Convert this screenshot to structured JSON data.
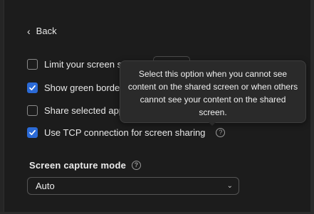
{
  "nav": {
    "back_label": "Back"
  },
  "options": [
    {
      "label": "Limit your screen s",
      "checked": false
    },
    {
      "label": "Show green border",
      "checked": true
    },
    {
      "label": "Share selected app",
      "checked": false
    },
    {
      "label": "Use TCP connection for screen sharing",
      "checked": true
    }
  ],
  "tooltip": {
    "text": "Select this option when you cannot see content on the shared screen or when others cannot see your content on the shared screen."
  },
  "capture": {
    "title": "Screen capture mode",
    "selected": "Auto"
  },
  "icons": {
    "back": "chevron-left-icon",
    "help": "question-circle-icon",
    "checkmark": "checkmark-icon",
    "caret": "chevron-down-icon"
  },
  "colors": {
    "checkbox_on": "#2b6ad6",
    "background": "#1c1c1c",
    "tooltip_bg": "#2a2a2a"
  }
}
